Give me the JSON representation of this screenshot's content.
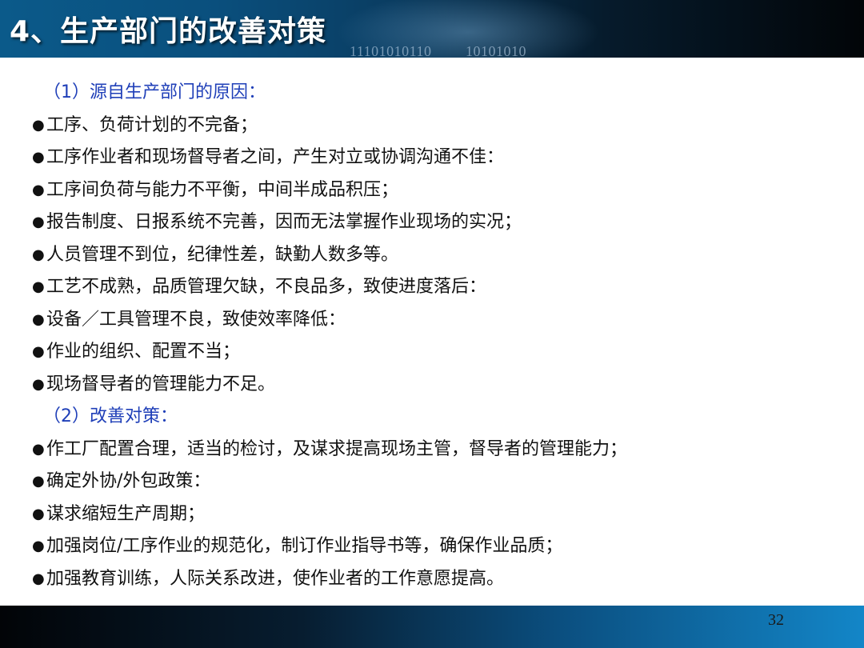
{
  "header": {
    "title": "4、生产部门的改善对策",
    "binary_left": "11101010110",
    "binary_right": "10101010"
  },
  "section1": {
    "heading": "（1）源自生产部门的原因：",
    "items": [
      "工序、负荷计划的不完备；",
      "工序作业者和现场督导者之间，产生对立或协调沟通不佳：",
      "工序间负荷与能力不平衡，中间半成品积压；",
      "报告制度、日报系统不完善，因而无法掌握作业现场的实况；",
      "人员管理不到位，纪律性差，缺勤人数多等。",
      "工艺不成熟，品质管理欠缺，不良品多，致使进度落后：",
      "设备／工具管理不良，致使效率降低：",
      "作业的组织、配置不当；",
      "现场督导者的管理能力不足。"
    ]
  },
  "section2": {
    "heading": "（2）改善对策：",
    "items": [
      "作工厂配置合理，适当的检讨，及谋求提高现场主管，督导者的管理能力；",
      "确定外协/外包政策：",
      "谋求缩短生产周期；",
      "加强岗位/工序作业的规范化，制订作业指导书等，确保作业品质；",
      "加强教育训练，人际关系改进，使作业者的工作意愿提高。"
    ]
  },
  "bullet_symbol": "●",
  "footer": {
    "page_number": "32"
  },
  "colors": {
    "heading_blue": "#1f3fb8",
    "body_text": "#111111",
    "header_dark": "#020508",
    "header_blue": "#0b5a8a"
  }
}
